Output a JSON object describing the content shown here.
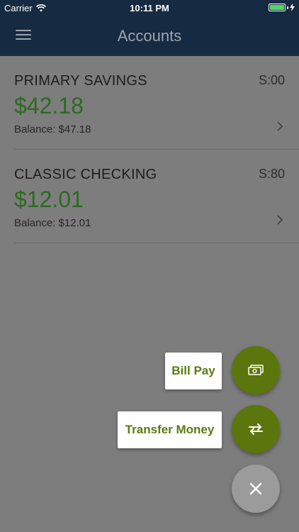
{
  "status_bar": {
    "carrier": "Carrier",
    "time": "10:11 PM",
    "battery_color": "#4cd964"
  },
  "nav": {
    "title": "Accounts",
    "menu_icon": "hamburger-menu-icon"
  },
  "accounts": [
    {
      "name": "PRIMARY SAVINGS",
      "code": "S:00",
      "available": "$42.18",
      "balance": "Balance: $47.18"
    },
    {
      "name": "CLASSIC CHECKING",
      "code": "S:80",
      "available": "$12.01",
      "balance": "Balance: $12.01"
    }
  ],
  "fab_menu": {
    "bill_pay_label": "Bill Pay",
    "bill_pay_icon": "cash-icon",
    "transfer_label": "Transfer Money",
    "transfer_icon": "transfer-arrows-icon",
    "close_icon": "close-icon"
  },
  "colors": {
    "header_bg": "#162a42",
    "amount_green": "#2c6a22",
    "fab_green": "#5b760c",
    "fab_label_text": "#5a7b12",
    "overlay_gray": "#7d7d7d"
  }
}
